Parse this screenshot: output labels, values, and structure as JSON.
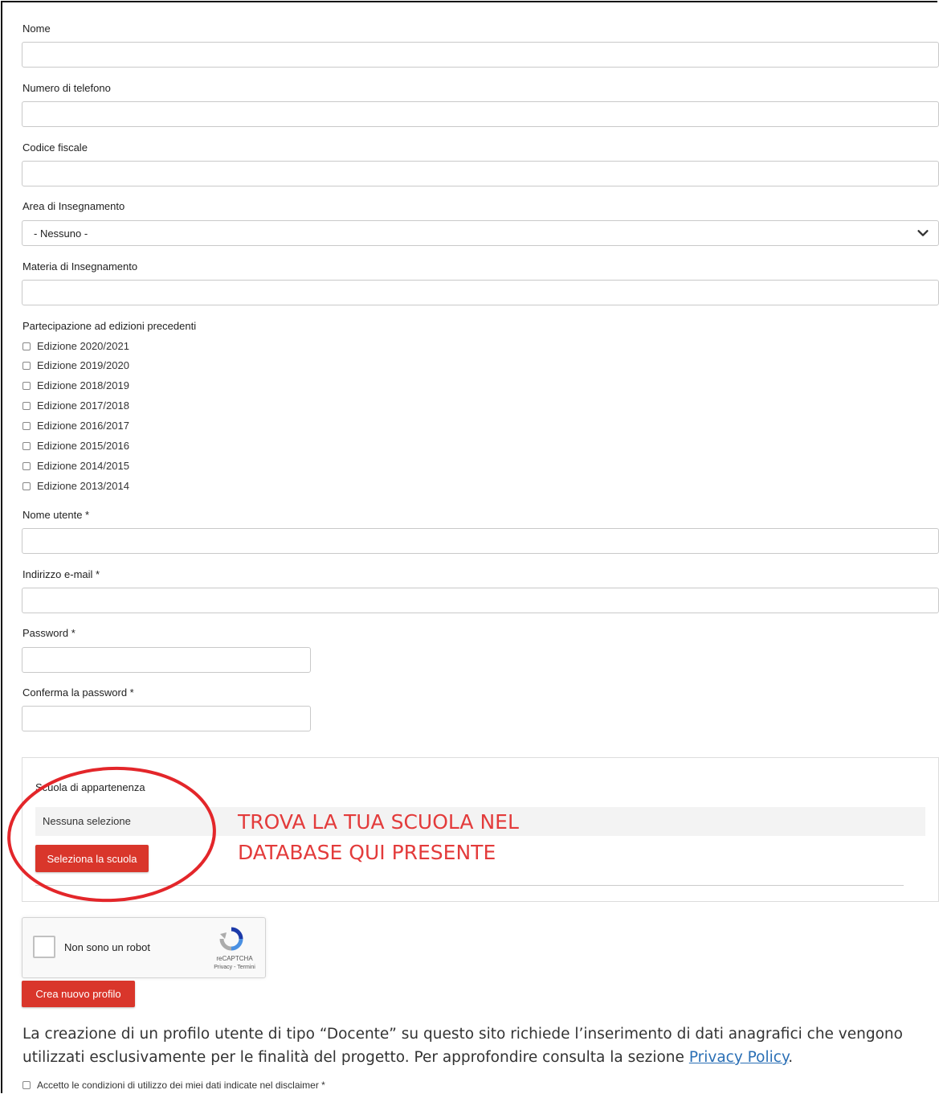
{
  "fields": {
    "nome_label": "Nome",
    "telefono_label": "Numero di telefono",
    "codice_fiscale_label": "Codice fiscale",
    "area_label": "Area di Insegnamento",
    "area_value": "- Nessuno -",
    "materia_label": "Materia di Insegnamento",
    "partecipazione_label": "Partecipazione ad edizioni precedenti",
    "edizioni": [
      "Edizione 2020/2021",
      "Edizione 2019/2020",
      "Edizione 2018/2019",
      "Edizione 2017/2018",
      "Edizione 2016/2017",
      "Edizione 2015/2016",
      "Edizione 2014/2015",
      "Edizione 2013/2014"
    ],
    "username_label": "Nome utente *",
    "email_label": "Indirizzo e-mail *",
    "password_label": "Password *",
    "confirm_password_label": "Conferma la password *"
  },
  "school": {
    "label": "Scuola di appartenenza",
    "selection": "Nessuna selezione",
    "button_label": "Seleziona la scuola",
    "annotation_line1": "TROVA LA TUA SCUOLA NEL",
    "annotation_line2": "DATABASE QUI PRESENTE",
    "annotation_color": "#e33b3b"
  },
  "captcha": {
    "text": "Non sono un robot",
    "brand": "reCAPTCHA",
    "links": "Privacy - Termini"
  },
  "submit": {
    "label": "Crea nuovo profilo",
    "color": "#d9362b"
  },
  "disclaimer": {
    "text_before": "La creazione di un profilo utente di tipo “Docente” su questo sito richiede l’inserimento di dati anagrafici che vengono utilizzati esclusivamente per le finalità del progetto. Per approfondire consulta la sezione ",
    "link": "Privacy Policy",
    "text_after": ".",
    "accept_label": "Accetto le condizioni di utilizzo dei miei dati indicate nel disclaimer *"
  }
}
